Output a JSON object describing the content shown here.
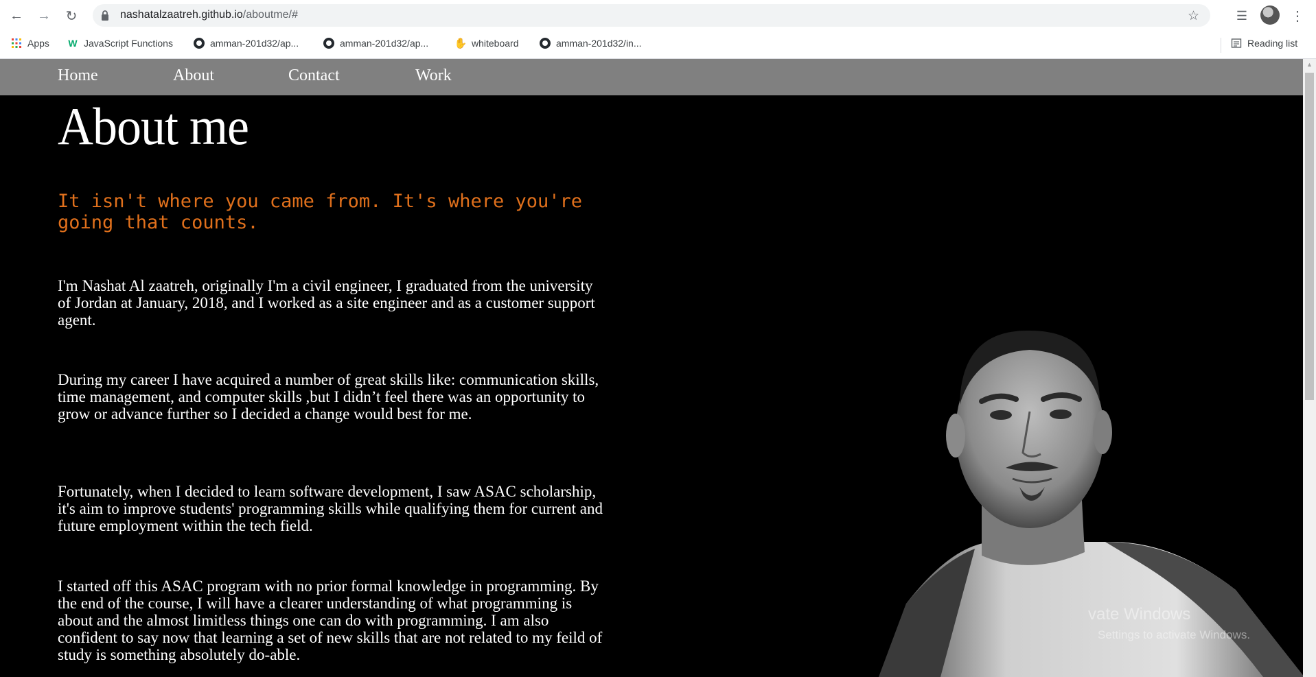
{
  "browser": {
    "url_host": "nashatalzaatreh.github.io",
    "url_path": "/aboutme/#",
    "bookmarks": [
      {
        "label": "Apps",
        "icon": "apps-grid-icon"
      },
      {
        "label": "JavaScript Functions",
        "icon": "w3schools-icon"
      },
      {
        "label": "amman-201d32/ap...",
        "icon": "github-icon"
      },
      {
        "label": "amman-201d32/ap...",
        "icon": "github-icon"
      },
      {
        "label": "whiteboard",
        "icon": "hand-icon"
      },
      {
        "label": "amman-201d32/in...",
        "icon": "github-icon"
      }
    ],
    "reading_list_label": "Reading list"
  },
  "nav": {
    "items": [
      {
        "label": "Home"
      },
      {
        "label": "About"
      },
      {
        "label": "Contact"
      },
      {
        "label": "Work"
      }
    ]
  },
  "content": {
    "title": "About me",
    "quote": "It isn't where you came from. It's where you're going that counts.",
    "paragraphs": [
      "I'm Nashat Al zaatreh, originally I'm a civil engineer, I graduated from the university of Jordan at January, 2018, and I worked as a site engineer and as a customer support agent.",
      "During my career I have acquired a number of great skills like: communication skills, time management, and computer skills ,but I didn’t feel there was an opportunity to grow or advance further so I decided a change would best for me.",
      "Fortunately, when I decided to learn software development, I saw ASAC scholarship, it's aim to improve students' programming skills while qualifying them for current and future employment within the tech field.",
      "I started off this ASAC program with no prior formal knowledge in programming. By the end of the course, I will have a clearer understanding of what programming is about and the almost limitless things one can do with programming. I am also confident to say now that learning a set of new skills that are not related to my feild of study is something absolutely do-able."
    ]
  },
  "watermark": {
    "line1": "vate Windows",
    "line2": "Settings to activate Windows."
  },
  "colors": {
    "nav_bg": "#808080",
    "page_bg": "#000000",
    "quote": "#e0701c"
  }
}
